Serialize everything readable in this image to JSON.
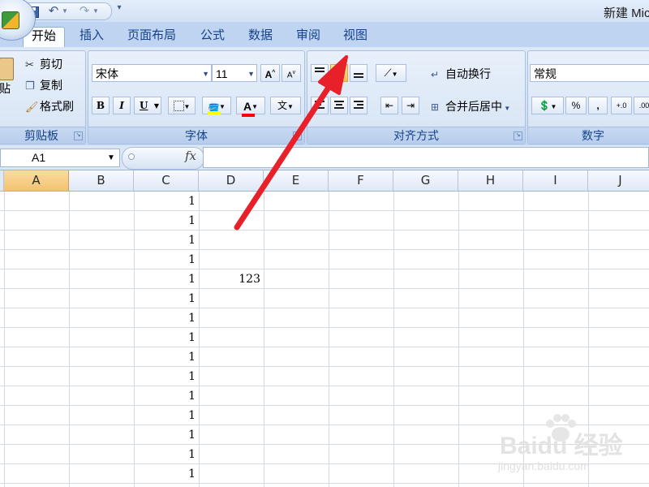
{
  "title_bar": {
    "title": "新建 Mic"
  },
  "ribbon_tabs": [
    {
      "label": "开始"
    },
    {
      "label": "插入"
    },
    {
      "label": "页面布局"
    },
    {
      "label": "公式"
    },
    {
      "label": "数据"
    },
    {
      "label": "审阅"
    },
    {
      "label": "视图"
    }
  ],
  "clipboard": {
    "group_label": "剪贴板",
    "paste_label": "贴",
    "cut_label": "剪切",
    "copy_label": "复制",
    "format_painter_label": "格式刷"
  },
  "font": {
    "group_label": "字体",
    "font_name": "宋体",
    "font_size": "11",
    "bold_label": "B",
    "italic_label": "I",
    "underline_label": "U",
    "grow_label": "A",
    "shrink_label": "A",
    "font_color_label": "A",
    "phonetic_label": "文",
    "fill_color": "#ffff00",
    "font_color": "#ff0000"
  },
  "alignment": {
    "group_label": "对齐方式",
    "wrap_text_label": "自动换行",
    "merge_center_label": "合并后居中"
  },
  "number": {
    "group_label": "数字",
    "format": "常规",
    "percent_label": "%",
    "comma_label": ","
  },
  "formula_bar": {
    "name_box": "A1",
    "fx": "fx",
    "formula": ""
  },
  "columns": [
    "A",
    "B",
    "C",
    "D",
    "E",
    "F",
    "G",
    "H",
    "I",
    "J"
  ],
  "cells": [
    {
      "col": "C",
      "row_index": 0,
      "value": "1"
    },
    {
      "col": "C",
      "row_index": 1,
      "value": "1"
    },
    {
      "col": "C",
      "row_index": 2,
      "value": "1"
    },
    {
      "col": "C",
      "row_index": 3,
      "value": "1"
    },
    {
      "col": "C",
      "row_index": 4,
      "value": "1"
    },
    {
      "col": "D",
      "row_index": 4,
      "value": "123"
    },
    {
      "col": "C",
      "row_index": 5,
      "value": "1"
    },
    {
      "col": "C",
      "row_index": 6,
      "value": "1"
    },
    {
      "col": "C",
      "row_index": 7,
      "value": "1"
    },
    {
      "col": "C",
      "row_index": 8,
      "value": "1"
    },
    {
      "col": "C",
      "row_index": 9,
      "value": "1"
    },
    {
      "col": "C",
      "row_index": 10,
      "value": "1"
    },
    {
      "col": "C",
      "row_index": 11,
      "value": "1"
    },
    {
      "col": "C",
      "row_index": 12,
      "value": "1"
    },
    {
      "col": "C",
      "row_index": 13,
      "value": "1"
    },
    {
      "col": "C",
      "row_index": 14,
      "value": "1"
    }
  ],
  "annotation": {
    "arrow_color": "#e8202a"
  },
  "watermark": {
    "text": "Baidu 经验",
    "sub": "jingyan.baidu.com"
  },
  "colors": {
    "ribbon": "#dbe6f4",
    "selected_header": "#f4c272",
    "tab_text": "#15428b"
  }
}
